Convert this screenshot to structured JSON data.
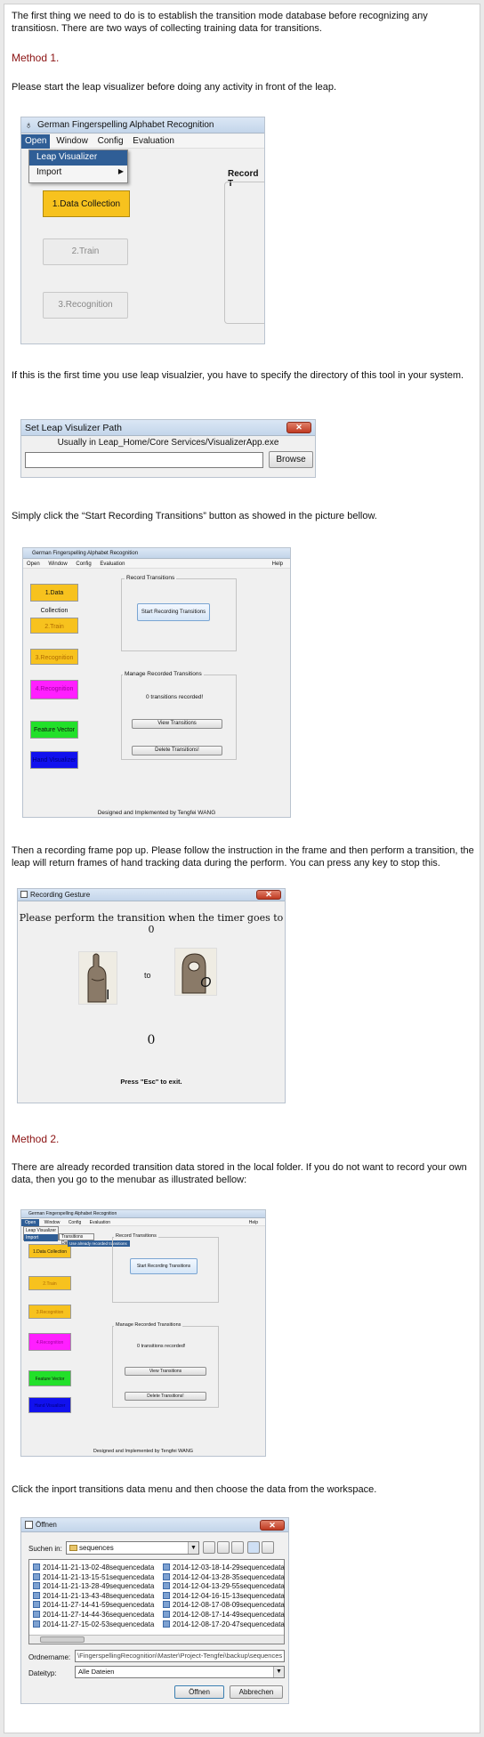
{
  "paragraphs": {
    "intro": "The first thing we need to do is to establish the transition mode database before recognizing any transitiosn. There are two ways of collecting training data for transitions.",
    "method1_heading": "Method 1.",
    "method1_text": "Please start the leap visualizer before doing any activity in front of the leap.",
    "first_time_text": "If this is the first time you use leap visualzier, you have to specify the directory of this tool in your system.",
    "click_text": "Simply click the “Start Recording Transitions”  button as showed in the picture bellow.",
    "popup_text": "Then a recording frame pop up. Please follow the instruction in the frame and then perform a transition, the leap will return frames of hand tracking data during the perform. You can press any key to stop this.",
    "method2_heading": "Method 2.",
    "method2_text": "There are already recorded transition data stored in the local folder. If you do not want to record your own data, then you go to the menubar as illustrated bellow:",
    "import_text": "Click the inport transitions data menu and then choose the data from the workspace."
  },
  "shot1": {
    "title": "German Fingerspelling Alphabet Recognition",
    "menu": [
      "Open",
      "Window",
      "Config",
      "Evaluation"
    ],
    "dropdown": [
      "Leap Visualizer",
      "Import"
    ],
    "data_collection": "1.Data Collection",
    "train": "2.Train",
    "recognition": "3.Recognition",
    "record_label": "Record T"
  },
  "shot2": {
    "title": "Set Leap Visulizer Path",
    "hint": "Usually in Leap_Home/Core Services/VisualizerApp.exe",
    "path_value": "",
    "browse": "Browse"
  },
  "shot3": {
    "title": "German Fingerspelling Alphabet Recognition",
    "menu": [
      "Open",
      "Window",
      "Config",
      "Evaluation"
    ],
    "help": "Help",
    "tiles": [
      {
        "label": "1.Data Collection",
        "color": "#f7c21e"
      },
      {
        "label": "2.Train",
        "color": "#f7c21e"
      },
      {
        "label": "3.Recognition",
        "color": "#f7c21e"
      },
      {
        "label": "4.Recognition",
        "color": "#ff1fff"
      },
      {
        "label": "Feature Vector",
        "color": "#22e02a"
      },
      {
        "label": "Hand Visualizer",
        "color": "#1111ee"
      }
    ],
    "record_panel": "Record Transitions",
    "start_button": "Start Recording Transitions",
    "manage_panel": "Manage Recorded Transitions",
    "count_text": "0  transitions recorded!",
    "view_button": "View Transitions",
    "delete_button": "Delete Transitions!",
    "footer": "Designed and Implemented by Tengfei WANG"
  },
  "shot4": {
    "title": "Recording Gesture",
    "instruction": "Please perform the transition when the timer goes to 0",
    "from_letter": "I",
    "to_word": "to",
    "to_letter": "O",
    "timer": "0",
    "esc_hint": "Press \"Esc\" to exit."
  },
  "shot5": {
    "title": "German Fingerspelling Alphabet Recognition",
    "menu": [
      "Open",
      "Window",
      "Config",
      "Evaluation"
    ],
    "help": "Help",
    "submenu": [
      "Leap Visualizer",
      "Import"
    ],
    "flyout": "Transitions Data",
    "flyout2": "Use already recorded transitions",
    "tiles": [
      {
        "label": "1.Data Collection",
        "color": "#f7c21e"
      },
      {
        "label": "2.Train",
        "color": "#f7c21e"
      },
      {
        "label": "3.Recognition",
        "color": "#f7c21e"
      },
      {
        "label": "4.Recognition",
        "color": "#ff1fff"
      },
      {
        "label": "Feature Vector",
        "color": "#22e02a"
      },
      {
        "label": "Hand Visualizer",
        "color": "#1111ee"
      }
    ],
    "record_panel": "Record Transitions",
    "start_button": "Start Recording Transitions",
    "manage_panel": "Manage Recorded Transitions",
    "count_text": "0  transitions recorded!",
    "view_button": "View Transitions",
    "delete_button": "Delete Transitions!",
    "footer": "Designed and Implemented by Tengfei WANG"
  },
  "shot6": {
    "title": "Öffnen",
    "look_in_label": "Suchen in:",
    "look_in_value": "sequences",
    "files_left": [
      "2014-11-21-13-02-48sequencedata",
      "2014-11-21-13-15-51sequencedata",
      "2014-11-21-13-28-49sequencedata",
      "2014-11-21-13-43-48sequencedata",
      "2014-11-27-14-41-59sequencedata",
      "2014-11-27-14-44-36sequencedata",
      "2014-11-27-15-02-53sequencedata"
    ],
    "files_right": [
      "2014-12-03-18-14-29sequencedata",
      "2014-12-04-13-28-35sequencedata",
      "2014-12-04-13-29-55sequencedata",
      "2014-12-04-16-15-13sequencedata",
      "2014-12-08-17-08-09sequencedata",
      "2014-12-08-17-14-49sequencedata",
      "2014-12-08-17-20-47sequencedata"
    ],
    "filename_label": "Ordnername:",
    "filename_value": "\\FingerspellingRecognition\\Master\\Project-Tengfei\\backup\\sequences",
    "filetype_label": "Dateityp:",
    "filetype_value": "Alle Dateien",
    "open_button": "Öffnen",
    "cancel_button": "Abbrechen"
  }
}
